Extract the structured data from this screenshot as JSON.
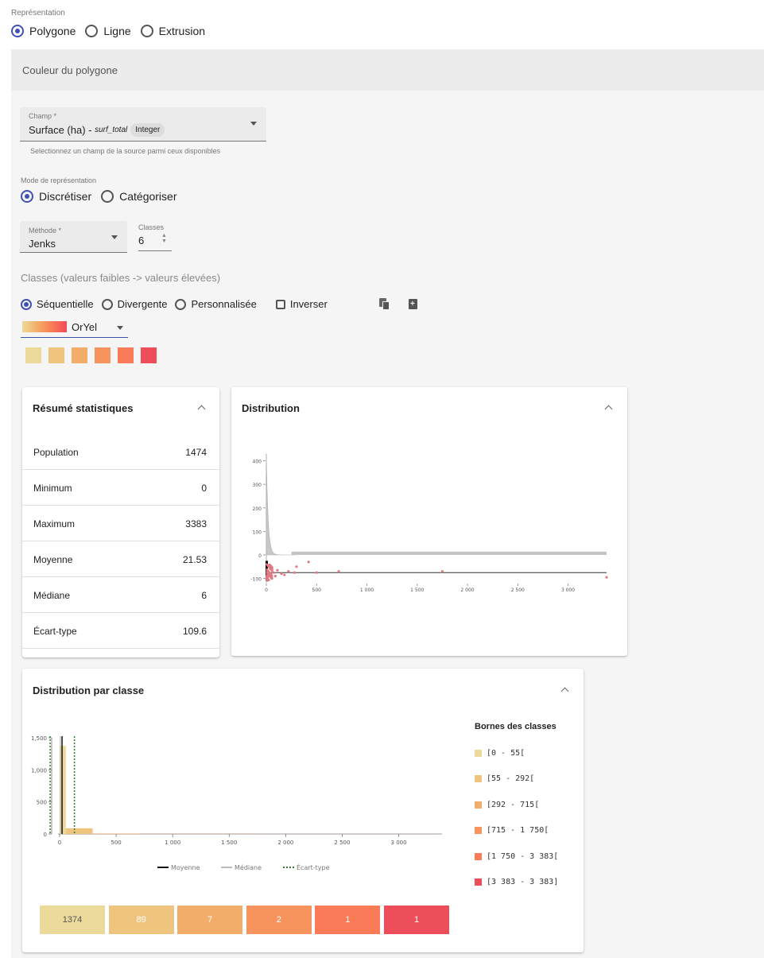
{
  "representation": {
    "label": "Représentation",
    "options": [
      "Polygone",
      "Ligne",
      "Extrusion"
    ],
    "selected": "Polygone"
  },
  "panel": {
    "title": "Couleur du polygone",
    "field": {
      "label": "Champ *",
      "value_name": "Surface (ha)",
      "value_sep": " - ",
      "value_attr": "surf_total",
      "value_type": "Integer",
      "hint": "Selectionnez un champ de la source parmi ceux disponibles"
    },
    "mode": {
      "label": "Mode de représentation",
      "options": [
        "Discrétiser",
        "Catégoriser"
      ],
      "selected": "Discrétiser"
    },
    "method": {
      "label": "Méthode *",
      "value": "Jenks"
    },
    "classes": {
      "label": "Classes",
      "value": "6"
    },
    "classes_heading": "Classes (valeurs faibles -> valeurs élevées)",
    "scheme": {
      "options": [
        "Séquentielle",
        "Divergente",
        "Personnalisée"
      ],
      "selected": "Séquentielle",
      "invert_label": "Inverser"
    },
    "palette": {
      "name": "OrYel",
      "colors": [
        "#ecda9a",
        "#efc47e",
        "#f3ad6a",
        "#f7945d",
        "#f97b57",
        "#f66356"
      ],
      "extra_color": "#ee4d5a"
    }
  },
  "stats_card": {
    "title": "Résumé statistiques",
    "rows": [
      {
        "k": "Population",
        "v": "1474"
      },
      {
        "k": "Minimum",
        "v": "0"
      },
      {
        "k": "Maximum",
        "v": "3383"
      },
      {
        "k": "Moyenne",
        "v": "21.53"
      },
      {
        "k": "Médiane",
        "v": "6"
      },
      {
        "k": "Écart-type",
        "v": "109.6"
      }
    ]
  },
  "dist_card": {
    "title": "Distribution"
  },
  "class_card": {
    "title": "Distribution par classe",
    "legend_title": "Bornes des classes",
    "bounds": [
      "[0 - 55[",
      "[55 - 292[",
      "[292 - 715[",
      "[715 - 1 750[",
      "[1 750 - 3 383[",
      "[3 383 - 3 383]"
    ],
    "bound_colors": [
      "#ecda9a",
      "#efc47e",
      "#f3ad6a",
      "#f7945d",
      "#f97b57",
      "#ee4d5a"
    ],
    "counts": [
      "1374",
      "89",
      "7",
      "2",
      "1",
      "1"
    ],
    "line_legend": [
      "Moyenne",
      "Médiane",
      "Écart-type"
    ]
  },
  "chart_data": [
    {
      "type": "scatter",
      "title": "Distribution",
      "x_ticks": [
        "0",
        "500",
        "1 000",
        "1 500",
        "2 000",
        "2 500",
        "3 000"
      ],
      "y_ticks": [
        "400",
        "300",
        "200",
        "100",
        "0",
        "-100"
      ],
      "xlim": [
        0,
        3383
      ],
      "ylim": [
        -120,
        430
      ],
      "histogram_peak": 420,
      "points_x": [
        5,
        10,
        15,
        20,
        30,
        40,
        55,
        70,
        90,
        110,
        150,
        180,
        220,
        280,
        300,
        420,
        500,
        720,
        1750,
        3383
      ],
      "points_y": [
        -90,
        -80,
        -95,
        -70,
        -85,
        -60,
        -100,
        -75,
        -90,
        -65,
        -80,
        -85,
        -70,
        -75,
        -50,
        -30,
        -75,
        -70,
        -70,
        -95
      ]
    },
    {
      "type": "bar",
      "title": "Distribution par classe",
      "x_ticks": [
        "0",
        "500",
        "1 000",
        "1 500",
        "2 000",
        "2 500",
        "3 000"
      ],
      "y_ticks": [
        "1,500",
        "1,000",
        "500",
        "0"
      ],
      "categories": [
        "[0 - 55[",
        "[55 - 292[",
        "[292 - 715[",
        "[715 - 1 750[",
        "[1 750 - 3 383[",
        "[3 383 - 3 383]"
      ],
      "x_ranges": [
        [
          0,
          55
        ],
        [
          55,
          292
        ],
        [
          292,
          715
        ],
        [
          715,
          1750
        ],
        [
          1750,
          3383
        ],
        [
          3383,
          3383
        ]
      ],
      "values": [
        1374,
        89,
        7,
        2,
        1,
        1
      ],
      "mean": 21.53,
      "median": 6,
      "std": 109.6,
      "xlim": [
        0,
        3383
      ],
      "ylim": [
        0,
        1500
      ]
    }
  ]
}
